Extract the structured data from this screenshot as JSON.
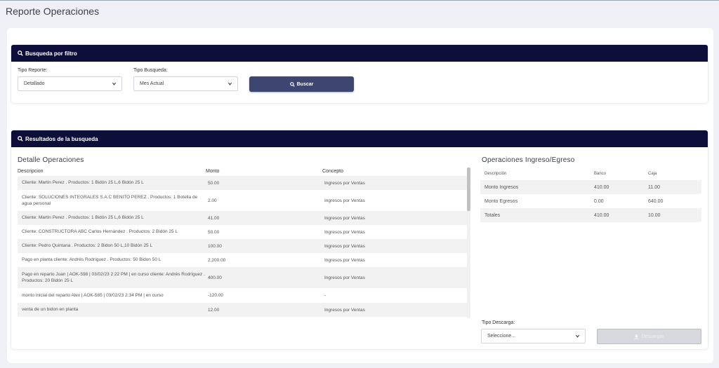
{
  "page": {
    "title": "Reporte Operaciones"
  },
  "filter": {
    "header": "Busqueda por filtro",
    "tipo_reporte_label": "Tipo Reporte:",
    "tipo_reporte_value": "Detallado",
    "tipo_busqueda_label": "Tipo Busqueda:",
    "tipo_busqueda_value": "Mes Actual",
    "buscar_label": "Buscar"
  },
  "results": {
    "header": "Resultados de la busqueda",
    "detalle_title": "Detalle Operaciones",
    "columns": [
      "Descripcion",
      "Monto",
      "Concepto"
    ],
    "rows": [
      {
        "descripcion": "Cliente: Martin Perez . Productos: 1 Bidón 25 L,6 Bidón 25 L",
        "monto": "50.00",
        "concepto": "Ingresos por Ventas"
      },
      {
        "descripcion": "Cliente: SOLUCIONES INTEGRALES S.A.C BENITO PEREZ . Productos: 1 Botella de agua personal",
        "monto": "2.00",
        "concepto": "Ingresos por Ventas"
      },
      {
        "descripcion": "Cliente: Martin Perez . Productos: 1 Bidón 25 L,6 Bidón 25 L",
        "monto": "41.00",
        "concepto": "Ingresos por Ventas"
      },
      {
        "descripcion": "Cliente: CONSTRUCTORA ABC Carlos Hernández . Productos: 2 Bidón 25 L",
        "monto": "50.00",
        "concepto": "Ingresos por Ventas"
      },
      {
        "descripcion": "Cliente: Pedro Quintana . Productos: 2 Bidon 50 L,10 Bidón 25 L",
        "monto": "100.00",
        "concepto": "Ingresos por Ventas"
      },
      {
        "descripcion": "Pago en planta cliente: Andrés Rodríguez . Productos: 50 Bidon 50 L",
        "monto": "2,200.00",
        "concepto": "Ingresos por Ventas"
      },
      {
        "descripcion": "Pago en reparto Juan | AOK-598 | 03/02/23 2:22 PM | en curso cliente: Andrés Rodríguez . Productos: 20 Bidón 25 L",
        "monto": "400.00",
        "concepto": "Ingresos por Ventas"
      },
      {
        "descripcion": "monto inicial del reparto Alex | AOK-585 | 03/02/23 2:34 PM | en curso",
        "monto": "-120.00",
        "concepto": "-"
      },
      {
        "descripcion": "venta de un bidon en planta",
        "monto": "12.00",
        "concepto": "Ingresos por Ventas"
      }
    ],
    "ops_title": "Operaciones Ingreso/Egreso",
    "ops_columns": [
      "Descripción",
      "Banco",
      "Caja"
    ],
    "ops_rows": [
      {
        "descripcion": "Monto Ingresos",
        "banco": "410.00",
        "caja": "11.00"
      },
      {
        "descripcion": "Monto Egresos",
        "banco": "0.00",
        "caja": "640.00"
      },
      {
        "descripcion": "Totales",
        "banco": "410.00",
        "caja": "10.00"
      }
    ],
    "tipo_descarga_label": "Tipo Descarga:",
    "tipo_descarga_value": "Seleccione...",
    "descargar_label": "Descargar"
  }
}
